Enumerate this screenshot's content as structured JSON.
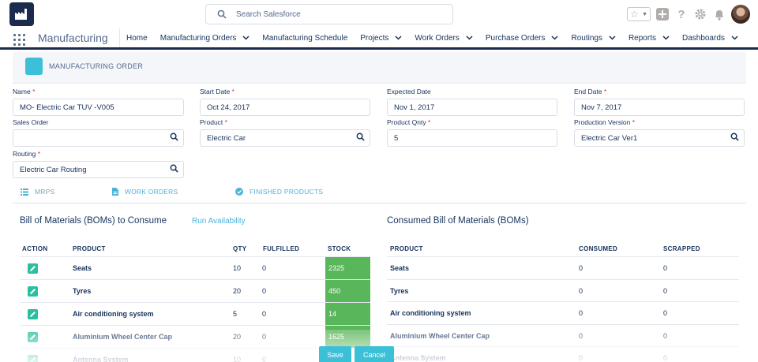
{
  "header": {
    "search_placeholder": "Search Salesforce"
  },
  "nav": {
    "app_name": "Manufacturing",
    "items": [
      {
        "label": "Home",
        "chevron": false
      },
      {
        "label": "Manufacturing Orders",
        "chevron": true
      },
      {
        "label": "Manufacturing Schedule",
        "chevron": false
      },
      {
        "label": "Projects",
        "chevron": true
      },
      {
        "label": "Work Orders",
        "chevron": true
      },
      {
        "label": "Purchase Orders",
        "chevron": true
      },
      {
        "label": "Routings",
        "chevron": true
      },
      {
        "label": "Reports",
        "chevron": true
      },
      {
        "label": "Dashboards",
        "chevron": true
      }
    ]
  },
  "record": {
    "title": "MANUFACTURING ORDER"
  },
  "form": {
    "name": {
      "label": "Name",
      "value": "MO- Electric Car TUV -V005"
    },
    "start_date": {
      "label": "Start Date",
      "value": "Oct 24, 2017"
    },
    "expected_date": {
      "label": "Expected Date",
      "value": "Nov 1, 2017"
    },
    "end_date": {
      "label": "End Date",
      "value": "Nov 7, 2017"
    },
    "sales_order": {
      "label": "Sales Order",
      "value": ""
    },
    "product": {
      "label": "Product",
      "value": "Electric Car"
    },
    "product_qnty": {
      "label": "Product Qnty",
      "value": "5"
    },
    "production_version": {
      "label": "Production Version",
      "value": "Electric Car Ver1"
    },
    "routing": {
      "label": "Routing",
      "value": "Electric Car Routing"
    },
    "required_mark": "*"
  },
  "tabs": [
    {
      "label": "MRPS",
      "icon": "list-icon",
      "active": true
    },
    {
      "label": "WORK ORDERS",
      "icon": "document-icon",
      "active": false
    },
    {
      "label": "FINISHED PRODUCTS",
      "icon": "check-circle-icon",
      "active": false
    }
  ],
  "bom_consume": {
    "title": "Bill of Materials (BOMs) to Consume",
    "run_link": "Run Availability",
    "headers": {
      "action": "ACTION",
      "product": "PRODUCT",
      "qty": "QTY",
      "fulfilled": "FULFILLED",
      "stock": "STOCK"
    },
    "rows": [
      {
        "product": "Seats",
        "qty": "10",
        "fulfilled": "0",
        "stock": "2325"
      },
      {
        "product": "Tyres",
        "qty": "20",
        "fulfilled": "0",
        "stock": "450"
      },
      {
        "product": "Air conditioning system",
        "qty": "5",
        "fulfilled": "0",
        "stock": "14"
      },
      {
        "product": "Aluminium Wheel Center Cap",
        "qty": "20",
        "fulfilled": "0",
        "stock": "1625"
      },
      {
        "product": "Antenna System",
        "qty": "10",
        "fulfilled": "0",
        "stock": ""
      }
    ]
  },
  "bom_consumed": {
    "title": "Consumed Bill of Materials (BOMs)",
    "headers": {
      "product": "PRODUCT",
      "consumed": "CONSUMED",
      "scrapped": "SCRAPPED"
    },
    "rows": [
      {
        "product": "Seats",
        "consumed": "0",
        "scrapped": "0"
      },
      {
        "product": "Tyres",
        "consumed": "0",
        "scrapped": "0"
      },
      {
        "product": "Air conditioning system",
        "consumed": "0",
        "scrapped": "0"
      },
      {
        "product": "Aluminium Wheel Center Cap",
        "consumed": "0",
        "scrapped": "0"
      },
      {
        "product": "Antenna System",
        "consumed": "0",
        "scrapped": "0"
      }
    ]
  },
  "footer": {
    "save_label": "Save",
    "cancel_label": "Cancel"
  },
  "colors": {
    "brand": "#1b2b4e",
    "accent": "#3cc0d8",
    "stock_ok": "#5ab65a",
    "edit": "#2abf9e"
  }
}
